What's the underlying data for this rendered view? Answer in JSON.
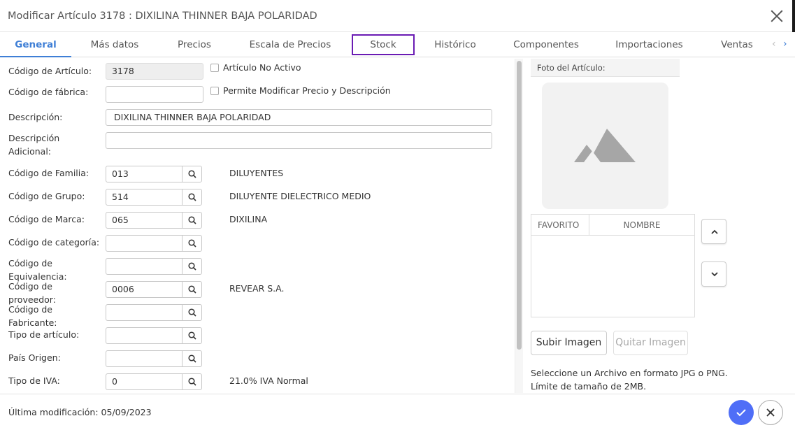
{
  "dialog": {
    "title": "Modificar Artículo 3178 : DIXILINA THINNER BAJA POLARIDAD"
  },
  "tabs": [
    "General",
    "Más datos",
    "Precios",
    "Escala de Precios",
    "Stock",
    "Histórico",
    "Componentes",
    "Importaciones",
    "Ventas"
  ],
  "form": {
    "codigo_articulo": {
      "label": "Código de Artículo:",
      "value": "3178"
    },
    "codigo_fabrica": {
      "label": "Código de fábrica:",
      "value": ""
    },
    "no_activo": {
      "label": "Artículo No Activo"
    },
    "permite_modificar": {
      "label": "Permite Modificar Precio y Descripción"
    },
    "descripcion": {
      "label": "Descripción:",
      "value": "DIXILINA THINNER BAJA POLARIDAD"
    },
    "descripcion_adicional": {
      "label1": "Descripción",
      "label2": "Adicional:",
      "value": ""
    },
    "familia": {
      "label": "Código de Familia:",
      "value": "013",
      "desc": "DILUYENTES"
    },
    "grupo": {
      "label": "Código de Grupo:",
      "value": "514",
      "desc": "DILUYENTE DIELECTRICO MEDIO"
    },
    "marca": {
      "label": "Código de Marca:",
      "value": "065",
      "desc": "DIXILINA"
    },
    "categoria": {
      "label": "Código de categoría:",
      "value": ""
    },
    "equivalencia": {
      "label1": "Código de",
      "label2": "Equivalencia:",
      "value": ""
    },
    "proveedor": {
      "label1": "Código de",
      "label2": "proveedor:",
      "value": "0006",
      "desc": "REVEAR S.A."
    },
    "fabricante": {
      "label1": "Código de",
      "label2": "Fabricante:",
      "value": ""
    },
    "tipo_articulo": {
      "label": "Tipo de artículo:",
      "value": ""
    },
    "pais_origen": {
      "label": "País Origen:",
      "value": ""
    },
    "tipo_iva": {
      "label": "Tipo de IVA:",
      "value": "0",
      "desc": "21.0% IVA Normal"
    }
  },
  "photo": {
    "header": "Foto del Artículo:",
    "col_favorito": "FAVORITO",
    "col_nombre": "NOMBRE",
    "upload_label": "Subir Imagen",
    "remove_label": "Quitar Imagen",
    "hint_line1": "Seleccione un Archivo en formato JPG o PNG.",
    "hint_line2": "Límite de tamaño de 2MB."
  },
  "footer": {
    "last_modified": "Última modificación: 05/09/2023"
  },
  "colors": {
    "accent": "#3f7fd6",
    "confirm": "#4f6ef7",
    "highlight": "#6a1bb3"
  }
}
